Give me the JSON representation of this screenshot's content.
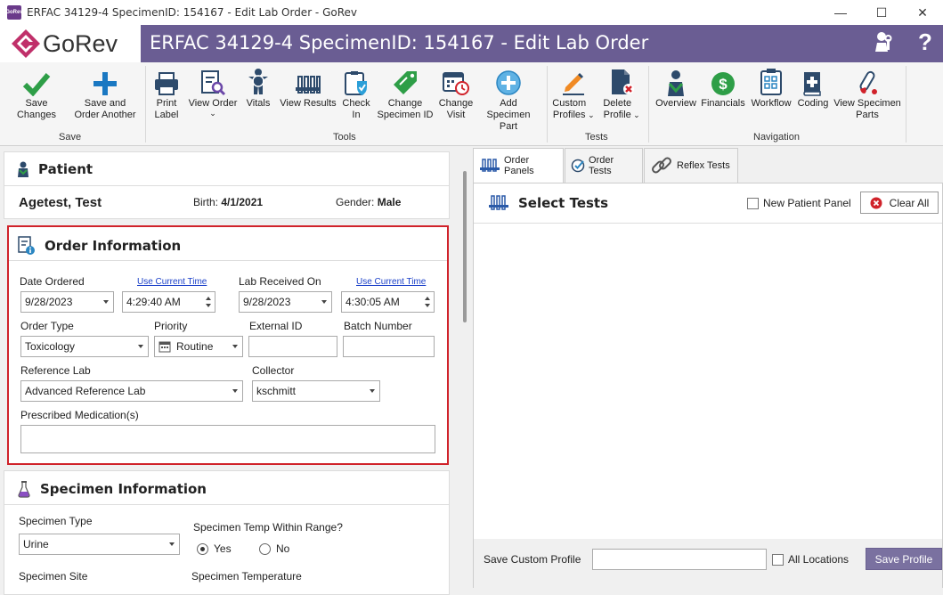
{
  "window": {
    "title": "ERFAC 34129-4 SpecimenID: 154167 - Edit Lab Order - GoRev",
    "app_icon": "GoRev",
    "minimize": "—",
    "maximize": "☐",
    "close": "✕"
  },
  "header": {
    "logo": "GoRev",
    "title": "ERFAC 34129-4 SpecimenID: 154167 - Edit Lab Order",
    "help": "?",
    "colors": {
      "bar": "#6a5d93",
      "logo_mark": "#c0306a"
    }
  },
  "ribbon": {
    "buttons": [
      {
        "id": "save-changes",
        "label": "Save Changes",
        "icon": "checkmark-icon"
      },
      {
        "id": "save-and-order-another",
        "label": "Save and\nOrder Another",
        "icon": "plus-icon"
      },
      {
        "id": "print-label",
        "label": "Print\nLabel",
        "icon": "printer-icon"
      },
      {
        "id": "view-order",
        "label": "View Order",
        "icon": "document-search-icon"
      },
      {
        "id": "vitals",
        "label": "Vitals",
        "icon": "body-icon"
      },
      {
        "id": "view-results",
        "label": "View Results",
        "icon": "test-tubes-icon"
      },
      {
        "id": "check-in",
        "label": "Check\nIn",
        "icon": "clipboard-shield-icon"
      },
      {
        "id": "change-specimen-id",
        "label": "Change\nSpecimen ID",
        "icon": "tag-icon"
      },
      {
        "id": "change-visit",
        "label": "Change\nVisit",
        "icon": "calendar-clock-icon"
      },
      {
        "id": "add-specimen-part",
        "label": "Add Specimen\nPart",
        "icon": "add-circle-icon"
      },
      {
        "id": "custom-profiles",
        "label": "Custom\nProfiles",
        "icon": "pencil-icon"
      },
      {
        "id": "delete-profile",
        "label": "Delete\nProfile",
        "icon": "document-delete-icon"
      },
      {
        "id": "overview",
        "label": "Overview",
        "icon": "person-icon"
      },
      {
        "id": "financials",
        "label": "Financials",
        "icon": "dollar-icon"
      },
      {
        "id": "workflow",
        "label": "Workflow",
        "icon": "clipboard-checklist-icon"
      },
      {
        "id": "coding",
        "label": "Coding",
        "icon": "book-plus-icon"
      },
      {
        "id": "view-specimen-parts",
        "label": "View Specimen\nParts",
        "icon": "specimen-tube-icon"
      }
    ],
    "groups": {
      "save": "Save",
      "tools": "Tools",
      "tests": "Tests",
      "navigation": "Navigation"
    }
  },
  "patient": {
    "heading": "Patient",
    "name": "Agetest, Test",
    "birth_label": "Birth:",
    "birth": "4/1/2021",
    "gender_label": "Gender:",
    "gender": "Male"
  },
  "order": {
    "heading": "Order Information",
    "date_ordered_label": "Date Ordered",
    "use_current_time": "Use Current Time",
    "date_ordered": "9/28/2023",
    "time_ordered": "4:29:40 AM",
    "lab_received_label": "Lab Received On",
    "lab_received_date": "9/28/2023",
    "lab_received_time": "4:30:05 AM",
    "order_type_label": "Order Type",
    "order_type": "Toxicology",
    "priority_label": "Priority",
    "priority": "Routine",
    "external_id_label": "External ID",
    "external_id": "",
    "batch_number_label": "Batch Number",
    "batch_number": "",
    "reference_lab_label": "Reference Lab",
    "reference_lab": "Advanced Reference Lab",
    "collector_label": "Collector",
    "collector": "kschmitt",
    "prescribed_meds_label": "Prescribed Medication(s)",
    "prescribed_meds": "",
    "highlight_color": "#d0222a"
  },
  "specimen": {
    "heading": "Specimen Information",
    "type_label": "Specimen Type",
    "type": "Urine",
    "temp_range_label": "Specimen Temp Within Range?",
    "yes": "Yes",
    "no": "No",
    "temp_in_range": true,
    "site_label": "Specimen Site",
    "temperature_label": "Specimen Temperature"
  },
  "tests_panel": {
    "tabs": [
      {
        "label": "Order Panels",
        "icon": "test-tubes-icon",
        "active": true
      },
      {
        "label": "Order Tests",
        "icon": "check-circle-icon",
        "active": false
      },
      {
        "label": "Reflex Tests",
        "icon": "chain-link-icon",
        "active": false
      }
    ],
    "heading": "Select Tests",
    "new_patient_panel": "New Patient Panel",
    "new_patient_panel_checked": false,
    "clear_all": "Clear All",
    "save_custom_profile_label": "Save Custom Profile",
    "save_custom_profile_value": "",
    "all_locations": "All Locations",
    "all_locations_checked": false,
    "save_profile": "Save Profile"
  }
}
